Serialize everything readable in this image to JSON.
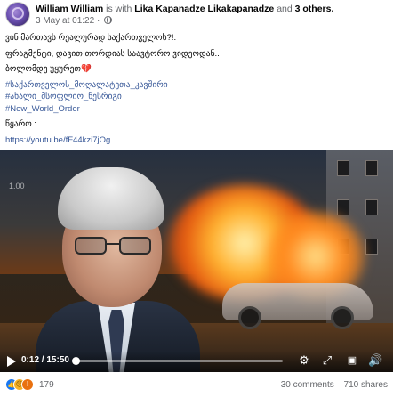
{
  "post": {
    "author": "William William",
    "with_prefix": "is with",
    "tagged": "Lika Kapanadze Likakapanadze",
    "and_text": "and",
    "others": "3 others.",
    "timestamp": "3 May at 01:22",
    "lines": [
      "ვინ მართავს რეალურად საქართველოს?!.",
      "ფრაგმენტი, დავით თორდიას საავტორო ვიდეოდან..",
      "ბოლომდე უყურეთ"
    ],
    "hashtags": [
      "#საქართველოს_მოღალატეთა_კავშირი",
      "#ახალი_მსოფლიო_წესრიგი",
      "#New_World_Order"
    ],
    "source_label": "წყარო :",
    "link": "https://youtu.be/fF44kzi7jOg"
  },
  "video": {
    "watermark": "1.00",
    "current_time": "0:12",
    "duration": "15:50",
    "progress": 0.013
  },
  "footer": {
    "reaction_count": "179",
    "comments": "30 comments",
    "shares": "710 shares"
  },
  "icons": {
    "play": "play-icon",
    "settings": "gear-icon",
    "fullscreen": "expand-icon",
    "pip": "picture-in-picture-icon",
    "volume": "speaker-icon"
  }
}
